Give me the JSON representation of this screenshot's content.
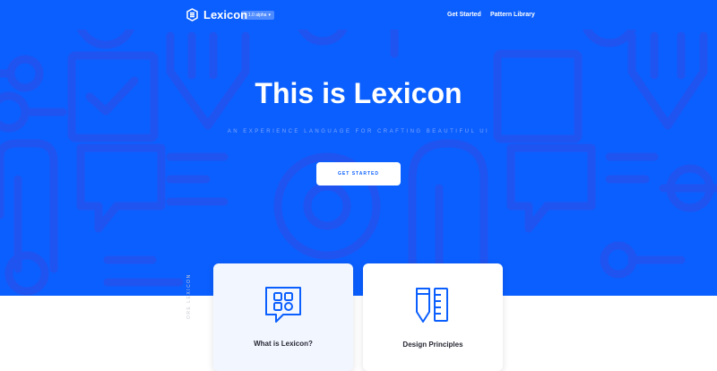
{
  "navbar": {
    "brand_name": "Lexicon",
    "version_badge": "v 1.0 alpha",
    "links": [
      {
        "label": "Get Started"
      },
      {
        "label": "Pattern Library"
      }
    ]
  },
  "hero": {
    "title": "This is Lexicon",
    "subtitle": "AN EXPERIENCE LANGUAGE FOR CRAFTING BEAUTIFUL UI",
    "cta_label": "GET STARTED"
  },
  "cards": [
    {
      "title": "What is Lexicon?",
      "icon": "chat-grid-icon"
    },
    {
      "title": "Design Principles",
      "icon": "pencil-ruler-icon"
    }
  ],
  "side_label": "ORE LEXICON",
  "colors": {
    "primary": "#0b5fff",
    "pattern": "#1f54f0",
    "subtitle": "#7fa6ff",
    "card_bg_highlight": "#f2f6ff",
    "text_dark": "#272833"
  }
}
